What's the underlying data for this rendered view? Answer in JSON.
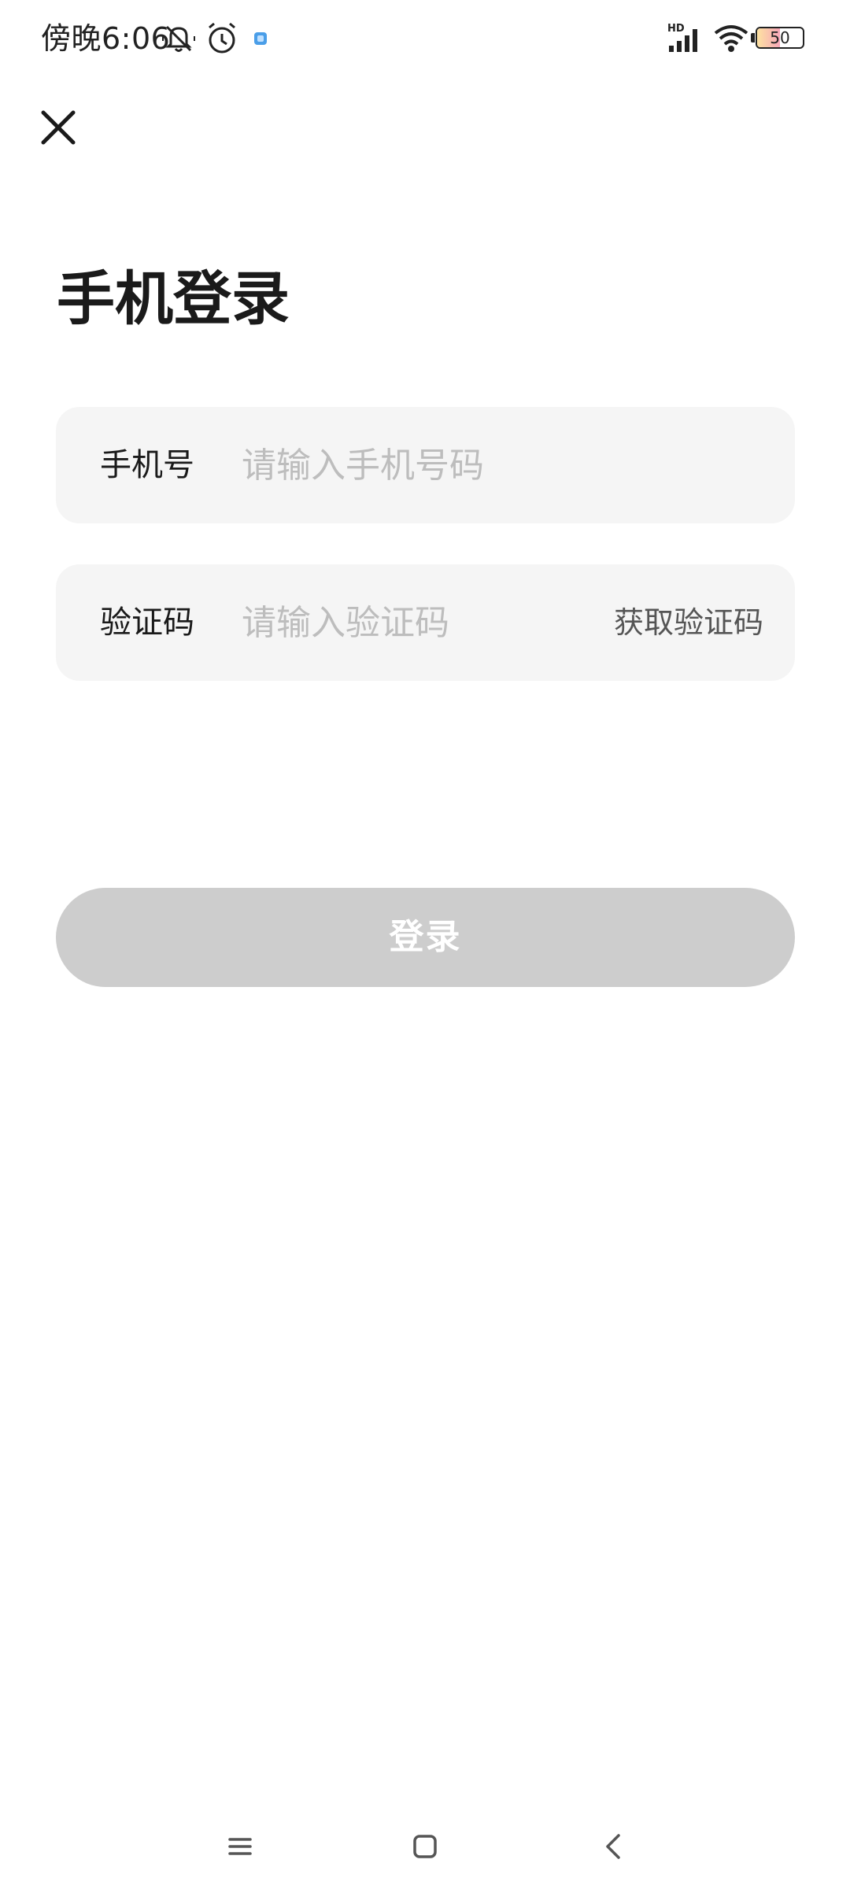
{
  "status_bar": {
    "time": "傍晚6:06",
    "battery_level": 50,
    "battery_text": "50",
    "network_label": "HD",
    "icons": [
      "mute-icon",
      "alarm-icon",
      "notification-icon",
      "signal-icon",
      "wifi-icon",
      "battery-icon"
    ]
  },
  "header": {
    "close_icon": "close-icon"
  },
  "page": {
    "title": "手机登录"
  },
  "phone_field": {
    "label": "手机号",
    "placeholder": "请输入手机号码",
    "value": ""
  },
  "code_field": {
    "label": "验证码",
    "placeholder": "请输入验证码",
    "value": "",
    "get_code_label": "获取验证码"
  },
  "login_button": {
    "label": "登录",
    "enabled": false,
    "color": "#cdcdcd"
  },
  "nav_bar": {
    "icons": [
      "menu-icon",
      "home-icon",
      "back-icon"
    ]
  }
}
